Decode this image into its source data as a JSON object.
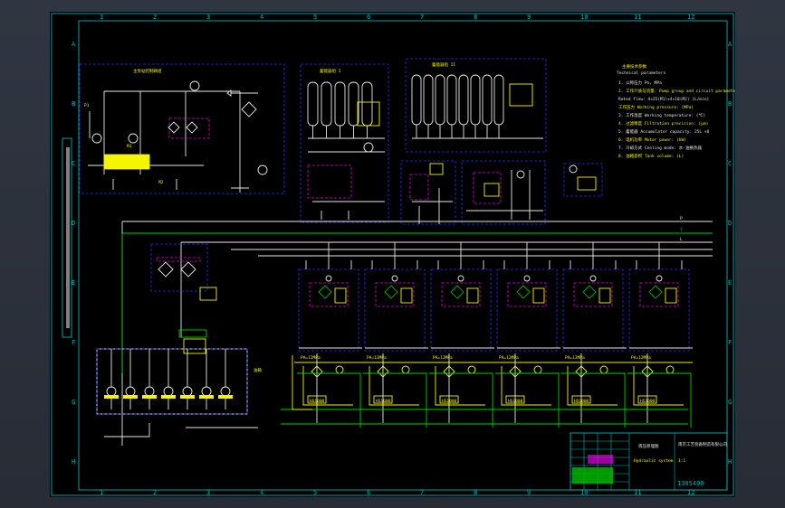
{
  "drawing": {
    "number": "1305400",
    "border_rows": [
      "A",
      "B",
      "C",
      "D",
      "E",
      "F",
      "G",
      "H"
    ],
    "border_cols": [
      "1",
      "2",
      "3",
      "4",
      "5",
      "6",
      "7",
      "8",
      "9",
      "10",
      "11",
      "12"
    ],
    "notes_title": "主要技术参数",
    "notes_subtitle": "Technical parameters",
    "notes": [
      "1. 公称压力 Pn, MPa",
      "2. 工作介质与流量: Pump group and circuit parameter",
      "Rated flow: 4×25(M1)+4×10(M2) (L/min)",
      "工作压力 Working pressure: (MPa)",
      "3. 工作温度 Working temperature: (℃)",
      "4. 过滤精度 Filtration precision: (μm)",
      "5. 蓄能器 Accumulator capacity: 25L ×8",
      "6. 电机功率 Motor power: (kW)",
      "7. 冷却方式 Cooling mode: 水-油换热器",
      "8. 油箱容积 Tank volume: (L)"
    ],
    "title_block": {
      "sheet_label": "液压原理图",
      "company": "南京工艺装备制造有限公司",
      "scale": "1:1",
      "designation": "Hydraulic system"
    }
  },
  "labels": {
    "unit_top_left": "主泵站控制阀组",
    "accum_group_1": "蓄能器组 I",
    "accum_group_2": "蓄能器组 II",
    "pressure_line": "P",
    "return_line": "T",
    "drain_line": "L",
    "tank": "油箱",
    "valve_label": "PA=12MPa"
  }
}
